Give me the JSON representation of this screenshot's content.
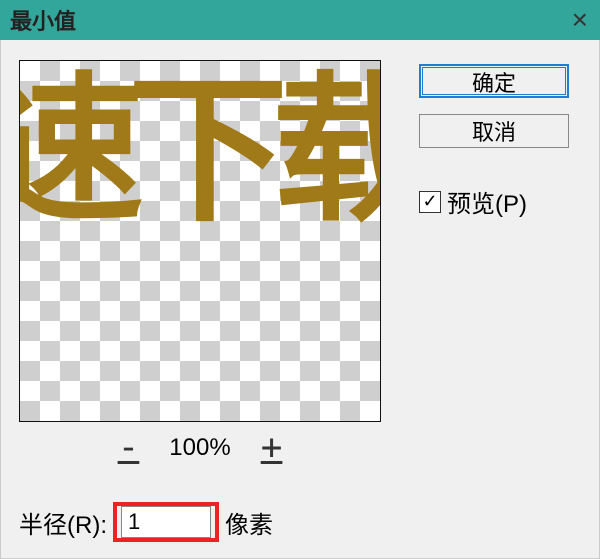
{
  "titlebar": {
    "title": "最小值",
    "close": "×"
  },
  "preview": {
    "sample_text": "速下载"
  },
  "zoom": {
    "out": "-",
    "level": "100%",
    "in": "+"
  },
  "radius": {
    "label": "半径(R):",
    "value": "1",
    "unit": "像素"
  },
  "buttons": {
    "ok": "确定",
    "cancel": "取消"
  },
  "preview_checkbox": {
    "checked": "✓",
    "label": "预览(P)"
  }
}
